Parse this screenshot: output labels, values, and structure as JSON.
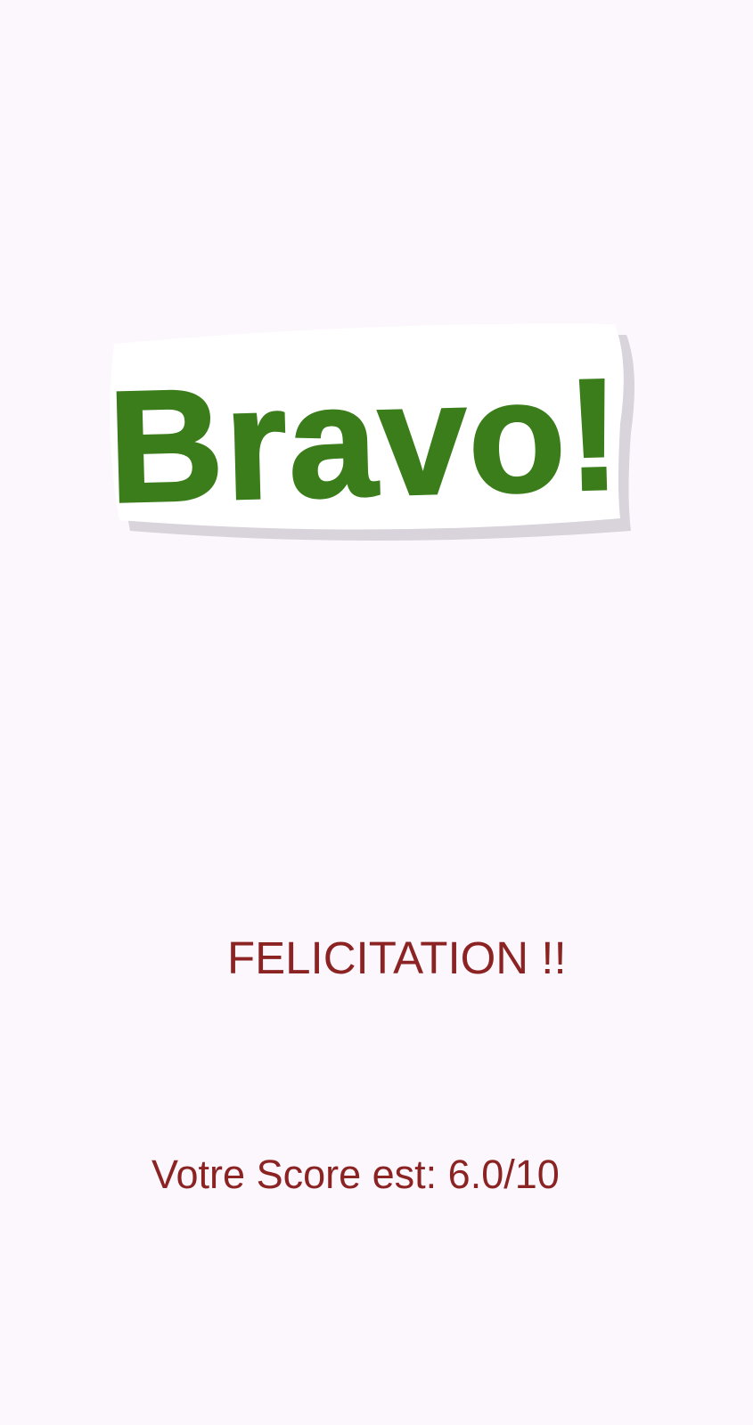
{
  "result_screen": {
    "sticker": {
      "text": "Bravo!",
      "icon": "bravo-sticker-icon",
      "fill_color": "#3a7d1a",
      "outline_color": "#ffffff",
      "shadow_color": "#d6d0d8"
    },
    "congrats_text": "FELICITATION !!",
    "score_text": "Votre Score est: 6.0/10",
    "score_value": 6.0,
    "score_max": 10,
    "text_color": "#8b2323",
    "background_color": "#fcf6fd"
  }
}
